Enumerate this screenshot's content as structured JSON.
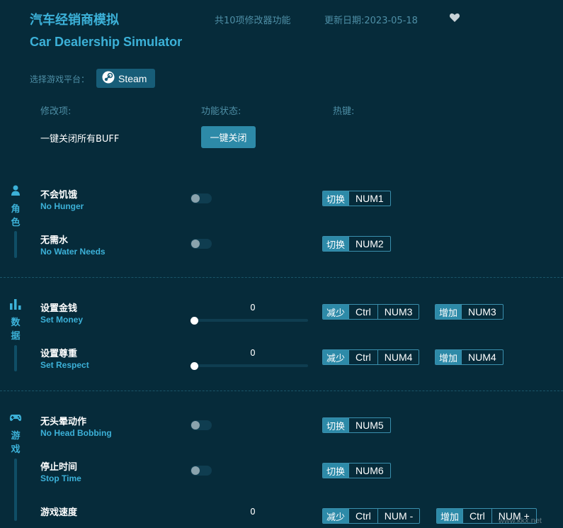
{
  "header": {
    "title_cn": "汽车经销商模拟",
    "title_en": "Car Dealership Simulator",
    "feature_count": "共10项修改器功能",
    "update_date": "更新日期:2023-05-18",
    "favorite_icon": "heart-icon"
  },
  "platform": {
    "label": "选择游戏平台：",
    "steam_label": "Steam",
    "steam_icon": "steam-icon"
  },
  "columns": {
    "item": "修改项:",
    "status": "功能状态:",
    "hotkey": "热键:"
  },
  "global": {
    "all_off_label": "一键关闭所有BUFF",
    "all_off_button": "一键关闭"
  },
  "sections": {
    "character": {
      "label_1": "角",
      "label_2": "色",
      "icon": "character-icon"
    },
    "data": {
      "label_1": "数",
      "label_2": "据",
      "icon": "bar-chart-icon"
    },
    "game": {
      "label_1": "游",
      "label_2": "戏",
      "icon": "gamepad-icon"
    }
  },
  "items": {
    "no_hunger": {
      "cn": "不会饥饿",
      "en": "No Hunger",
      "on": false,
      "tag": "切换",
      "key": "NUM1"
    },
    "no_water": {
      "cn": "无需水",
      "en": "No Water Needs",
      "on": false,
      "tag": "切换",
      "key": "NUM2"
    },
    "set_money": {
      "cn": "设置金钱",
      "en": "Set Money",
      "value": "0",
      "dec_tag": "减少",
      "dec_mod": "Ctrl",
      "dec_key": "NUM3",
      "inc_tag": "增加",
      "inc_key": "NUM3"
    },
    "set_respect": {
      "cn": "设置尊重",
      "en": "Set Respect",
      "value": "0",
      "dec_tag": "减少",
      "dec_mod": "Ctrl",
      "dec_key": "NUM4",
      "inc_tag": "增加",
      "inc_key": "NUM4"
    },
    "no_head_bob": {
      "cn": "无头晕动作",
      "en": "No Head Bobbing",
      "on": false,
      "tag": "切换",
      "key": "NUM5"
    },
    "stop_time": {
      "cn": "停止时间",
      "en": "Stop Time",
      "on": false,
      "tag": "切换",
      "key": "NUM6"
    },
    "game_speed": {
      "cn": "游戏速度",
      "value": "0",
      "dec_tag": "减少",
      "dec_mod": "Ctrl",
      "dec_key": "NUM -",
      "inc_tag": "增加",
      "inc_mod": "Ctrl",
      "inc_key": "NUM +"
    }
  },
  "watermark": "www.kkx.net",
  "colors": {
    "background": "#062b3a",
    "accent": "#3cb1d8",
    "button": "#2d8aa8"
  }
}
